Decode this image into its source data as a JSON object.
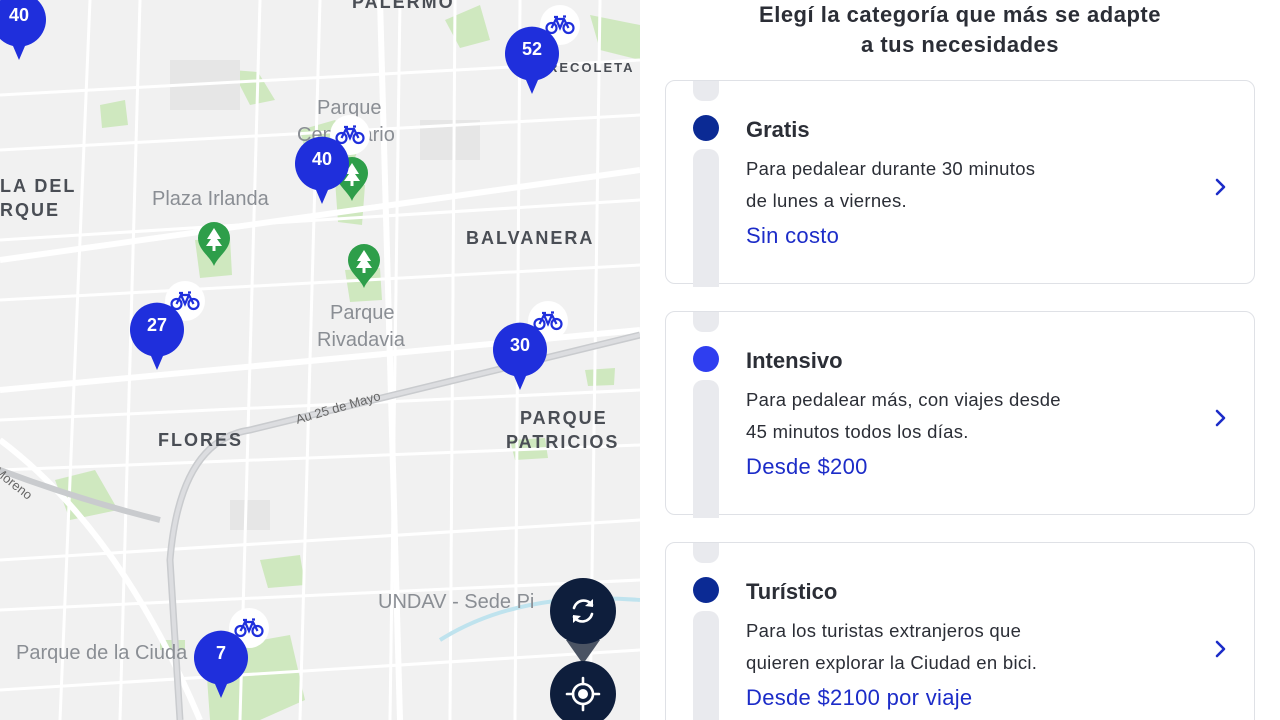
{
  "map": {
    "neighborhoods": {
      "palermo": "PALERMO",
      "recoleta": "RECOLETA",
      "la_del_1": "LA DEL",
      "la_del_2": "RQUE",
      "balvanera": "BALVANERA",
      "flores": "FLORES",
      "parque_patricios_1": "PARQUE",
      "parque_patricios_2": "PATRICIOS"
    },
    "places": {
      "parque_centenario_1": "Parque",
      "parque_centenario_2": "Centenario",
      "plaza_irlanda": "Plaza Irlanda",
      "parque_rivadavia_1": "Parque",
      "parque_rivadavia_2": "Rivadavia",
      "undav": "UNDAV - Sede Pi",
      "parque_ciudad": "Parque de la Ciuda"
    },
    "roads": {
      "au25": "Au 25 de Mayo",
      "moreno": "Moreno"
    },
    "clusters": [
      {
        "count": "40"
      },
      {
        "count": "52"
      },
      {
        "count": "40"
      },
      {
        "count": "27"
      },
      {
        "count": "30"
      },
      {
        "count": "7"
      }
    ],
    "buttons": {
      "refresh_icon": "refresh-icon",
      "locate_icon": "locate-icon"
    }
  },
  "panel": {
    "title_line1": "Elegí la categoría que más se adapte",
    "title_line2": "a tus necesidades",
    "plans": [
      {
        "name": "Gratis",
        "desc_line1": "Para pedalear durante 30 minutos",
        "desc_line2": "de lunes a viernes.",
        "price": "Sin costo",
        "dot_color": "#0b2a94"
      },
      {
        "name": "Intensivo",
        "desc_line1": "Para pedalear más, con viajes desde",
        "desc_line2": "45 minutos todos los días.",
        "price": "Desde $200",
        "dot_color": "#2f3ef0"
      },
      {
        "name": "Turístico",
        "desc_line1": "Para los turistas extranjeros que",
        "desc_line2": "quieren explorar la Ciudad en bici.",
        "price": "Desde $2100 por viaje",
        "dot_color": "#0b2a94"
      }
    ]
  },
  "colors": {
    "cluster_blue": "#1f2fdc",
    "park_green": "#cfe8bf",
    "tree_pin_green": "#2e9e4a",
    "button_navy": "#0e1e3c",
    "price_blue": "#1c2cc8"
  }
}
